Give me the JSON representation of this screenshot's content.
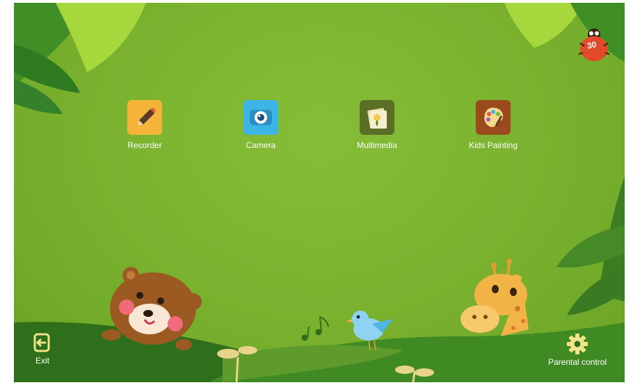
{
  "apps": [
    {
      "label": "Recorder",
      "icon": "recorder-pencil-icon",
      "color": "#f4b43a"
    },
    {
      "label": "Camera",
      "icon": "camera-icon",
      "color": "#3db4e6"
    },
    {
      "label": "Multimedia",
      "icon": "multimedia-photo-icon",
      "color": "#5b6e26"
    },
    {
      "label": "Kids Painting",
      "icon": "kids-painting-palette-icon",
      "color": "#9a4a1c"
    }
  ],
  "timer": {
    "value": "30"
  },
  "bottom": {
    "exit_label": "Exit",
    "parental_label": "Parental control"
  },
  "colors": {
    "background": "#79b12e",
    "hill_dark": "#2f6e1a",
    "hill_mid": "#3f8a23"
  }
}
